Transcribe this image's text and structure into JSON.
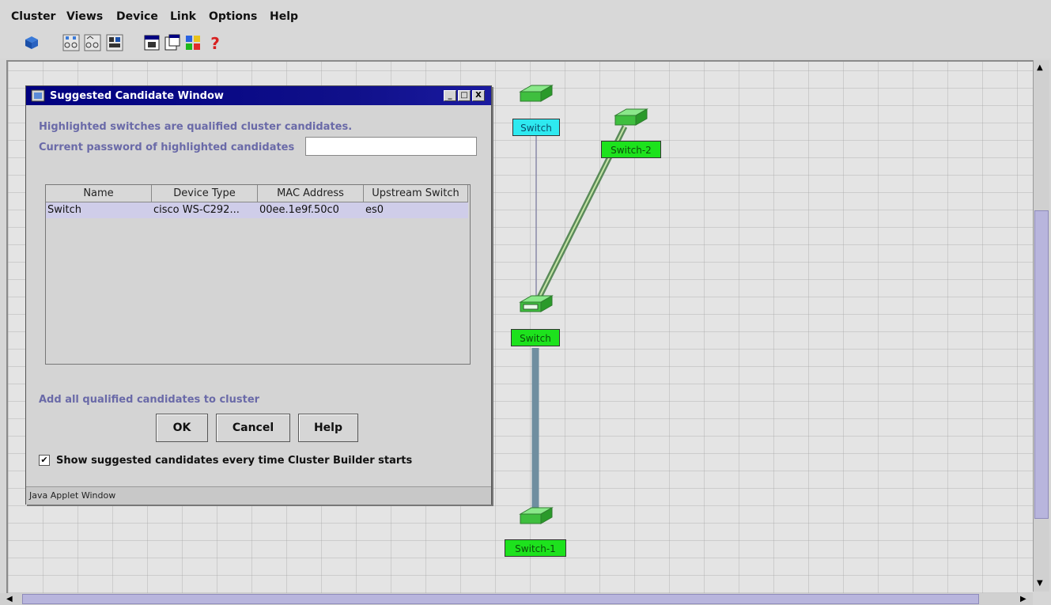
{
  "menu": [
    "Cluster",
    "Views",
    "Device",
    "Link",
    "Options",
    "Help"
  ],
  "toolbar_icons": [
    "cluster-icon",
    "link-graph-icon",
    "link-graph-2-icon",
    "devices-icon",
    "window-icon",
    "properties-icon",
    "legend-icon",
    "help-icon"
  ],
  "dialog": {
    "title": "Suggested Candidate Window",
    "window_buttons": [
      "_",
      "□",
      "X"
    ],
    "info": "Highlighted switches are qualified cluster candidates.",
    "password_label": "Current password of highlighted candidates",
    "password_value": "",
    "table": {
      "columns": [
        "Name",
        "Device Type",
        "MAC Address",
        "Upstream Switch"
      ],
      "rows": [
        [
          "Switch",
          "cisco WS-C292...",
          "00ee.1e9f.50c0",
          "es0"
        ]
      ]
    },
    "add_all_label": "Add all qualified candidates to cluster",
    "buttons": {
      "ok": "OK",
      "cancel": "Cancel",
      "help": "Help"
    },
    "show_checkbox": {
      "checked": true,
      "label": "Show suggested candidates every time Cluster Builder starts"
    },
    "status": "Java Applet Window"
  },
  "topology": {
    "nodes": [
      {
        "label": "Switch",
        "color": "#2ee9f0"
      },
      {
        "label": "Switch-2",
        "color": "#1de21d"
      },
      {
        "label": "Switch",
        "color": "#1de21d"
      },
      {
        "label": "Switch-1",
        "color": "#1de21d"
      }
    ]
  }
}
